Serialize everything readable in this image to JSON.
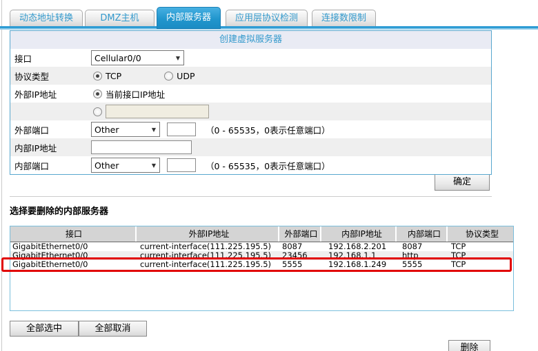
{
  "tabs": [
    {
      "label": "动态地址转换",
      "active": false
    },
    {
      "label": "DMZ主机",
      "active": false
    },
    {
      "label": "内部服务器",
      "active": true
    },
    {
      "label": "应用层协议检测",
      "active": false
    },
    {
      "label": "连接数限制",
      "active": false
    }
  ],
  "form": {
    "title": "创建虚拟服务器",
    "interface_label": "接口",
    "interface_value": "Cellular0/0",
    "protocol_label": "协议类型",
    "protocol_tcp": "TCP",
    "protocol_udp": "UDP",
    "protocol_selected": "TCP",
    "external_ip_label": "外部IP地址",
    "external_ip_current_option": "当前接口IP地址",
    "external_ip_custom_value": "",
    "external_port_label": "外部端口",
    "external_port_select_value": "Other",
    "external_port_value": "",
    "port_hint": "（0 - 65535，0表示任意端口）",
    "internal_ip_label": "内部IP地址",
    "internal_ip_value": "",
    "internal_port_label": "内部端口",
    "internal_port_select_value": "Other",
    "internal_port_value": "",
    "submit_label": "确定"
  },
  "delete_section": {
    "title": "选择要删除的内部服务器",
    "table": {
      "headers": [
        "接口",
        "外部IP地址",
        "外部端口",
        "内部IP地址",
        "内部端口",
        "协议类型"
      ],
      "rows": [
        [
          "GigabitEthernet0/0",
          "current-interface(111.225.195.5)",
          "8087",
          "192.168.2.201",
          "8087",
          "TCP"
        ],
        [
          "GigabitEthernet0/0",
          "current-interface(111.225.195.5)",
          "23456",
          "192.168.1.1",
          "http",
          "TCP"
        ],
        [
          "GigabitEthernet0/0",
          "current-interface(111.225.195.5)",
          "5555",
          "192.168.1.249",
          "5555",
          "TCP"
        ]
      ],
      "highlighted_row_index": 2
    },
    "select_all_label": "全部选中",
    "deselect_all_label": "全部取消",
    "delete_label": "删除"
  },
  "colors": {
    "accent_blue": "#2d9cd4",
    "tab_text_blue": "#3399cc",
    "form_border_blue": "#58a7ce",
    "table_border_blue": "#79bedc",
    "highlight_red": "#e10000",
    "alt_row_gray": "#efefef"
  }
}
